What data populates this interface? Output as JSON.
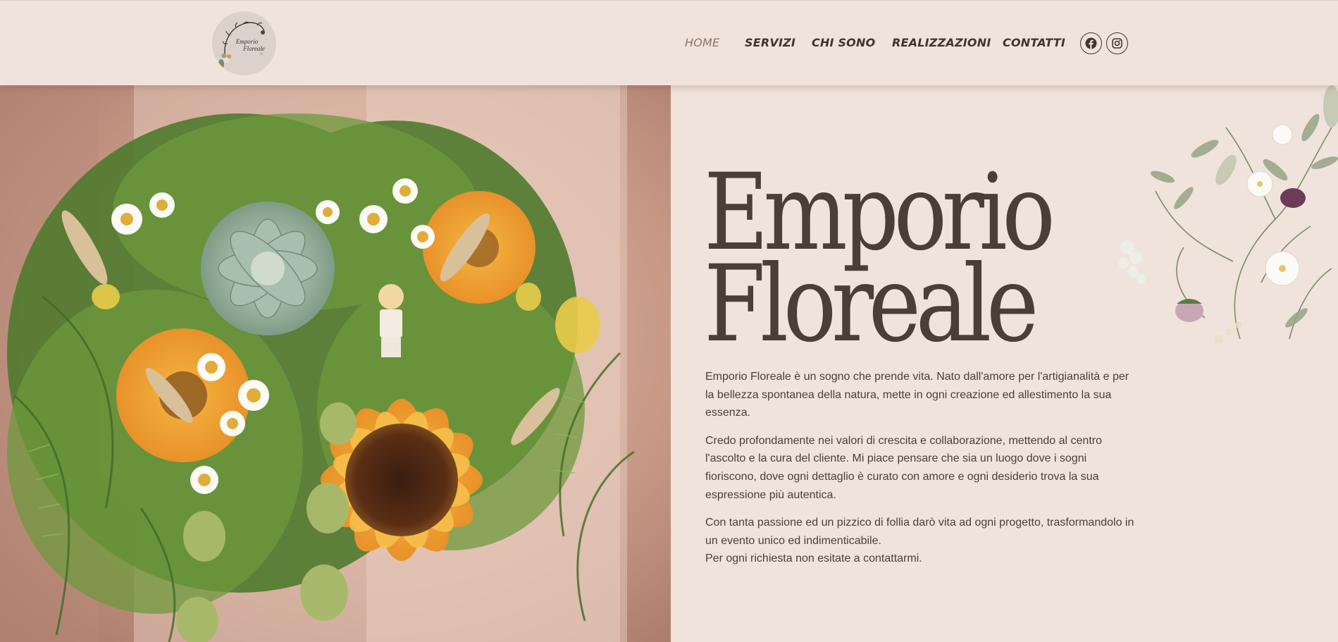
{
  "logo": {
    "line1": "Emporio",
    "line2": "Floreale"
  },
  "nav": {
    "items": [
      {
        "label": "HOME",
        "active": true
      },
      {
        "label": "SERVIZI",
        "active": false
      },
      {
        "label": "CHI SONO",
        "active": false
      },
      {
        "label": "REALIZZAZIONI",
        "active": false
      },
      {
        "label": "CONTATTI",
        "active": false
      }
    ],
    "social": [
      {
        "icon": "facebook-icon"
      },
      {
        "icon": "instagram-icon"
      }
    ]
  },
  "hero": {
    "title_line1": "Emporio",
    "title_line2": "Floreale",
    "paragraphs": [
      {
        "text": "Emporio Floreale è un sogno che prende vita. Nato dall'amore per l'artigianalità e per la bellezza spontanea della natura, mette in ogni creazione ed allestimento la sua essenza."
      },
      {
        "text": "Credo profondamente nei valori di crescita e collaborazione, mettendo al centro l'ascolto e la cura del cliente. Mi piace pensare che sia un luogo dove i sogni fioriscono, dove ogni dettaglio è curato con amore e ogni desiderio trova la sua espressione più autentica."
      },
      {
        "text": "Con tanta passione ed un pizzico di follia darò vita ad ogni progetto, trasformandolo in un evento unico ed indimenticabile."
      }
    ],
    "closing": "Per ogni richiesta non esitate a contattarmi."
  },
  "colors": {
    "background": "#f0e3db",
    "text": "#4a3f38",
    "nav_active": "#8a776a"
  }
}
